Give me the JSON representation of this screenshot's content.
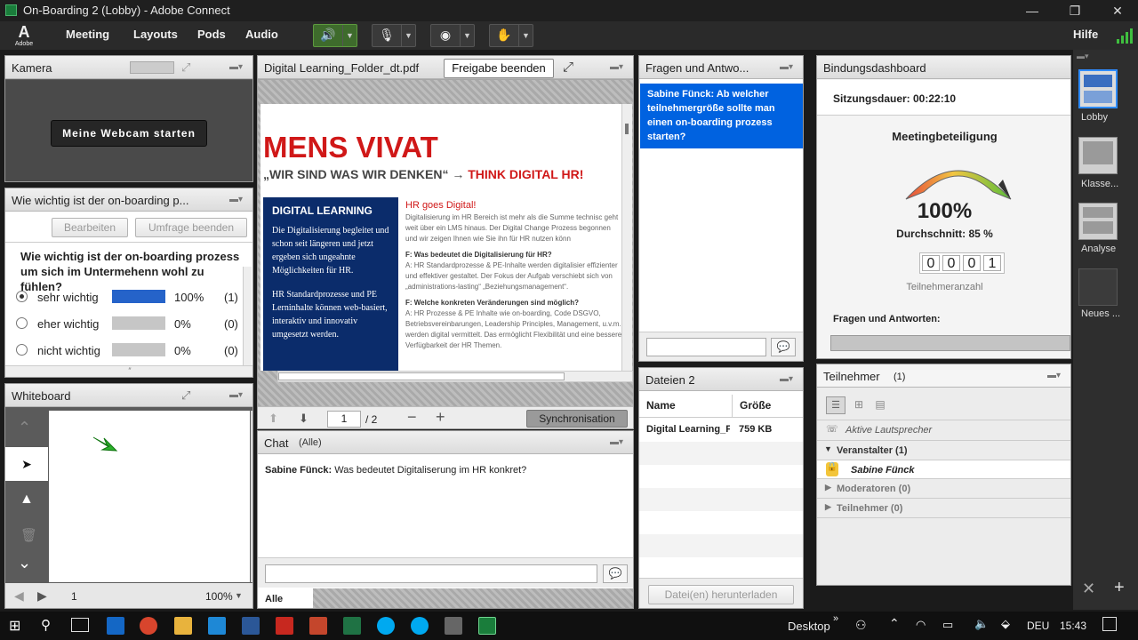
{
  "window": {
    "title": "On-Boarding 2 (Lobby) - Adobe Connect",
    "min": "—",
    "max": "❐",
    "close": "✕"
  },
  "menubar": {
    "logo": "A",
    "logo_text": "Adobe",
    "items": [
      "Meeting",
      "Layouts",
      "Pods",
      "Audio"
    ],
    "help": "Hilfe",
    "speaker_icon": "speaker-icon",
    "mic_icon": "mic-icon",
    "cam_icon": "camera-icon",
    "hand_icon": "raise-hand-icon"
  },
  "camera_pod": {
    "title": "Kamera",
    "start_button": "Meine Webcam starten"
  },
  "poll_pod": {
    "title": "Wie wichtig ist der on-boarding p...",
    "edit_button": "Bearbeiten",
    "end_button": "Umfrage beenden",
    "question": "Wie wichtig ist der on-boarding prozess um sich im Untermehenn wohl zu fühlen?",
    "answers": [
      {
        "label": "sehr wichtig",
        "percent": "100%",
        "count": "(1)",
        "fill": 100,
        "selected": true
      },
      {
        "label": "eher wichtig",
        "percent": "0%",
        "count": "(0)",
        "fill": 0,
        "selected": false
      },
      {
        "label": "nicht wichtig",
        "percent": "0%",
        "count": "(0)",
        "fill": 0,
        "selected": false
      }
    ]
  },
  "whiteboard_pod": {
    "title": "Whiteboard",
    "page": "1",
    "zoom": "100%"
  },
  "share_pod": {
    "filename": "Digital Learning_Folder_dt.pdf",
    "stop_button": "Freigabe beenden",
    "page_current": "1",
    "page_total": "/ 2",
    "sync_button": "Synchronisation",
    "doc": {
      "headline": "MENS VIVAT",
      "subline_a": "„WIR SIND WAS WIR DENKEN“ →",
      "subline_b": "THINK DIGITAL HR!",
      "blue_title": "DIGITAL LEARNING",
      "blue_p1": "Die Digitalisierung begleitet und schon seit längeren und jetzt ergeben sich ungeahnte Möglichkeiten für HR.",
      "blue_p2": "HR Standardprozesse und PE Lerninhalte können web-basiert, interaktiv und innovativ umgesetzt werden.",
      "red_title": "HR goes Digital!",
      "p1": "Digitalisierung im HR Bereich ist mehr als die Summe technisc geht weit über ein LMS hinaus. Der Digital Change Prozess begonnen und wir zeigen Ihnen wie Sie ihn für HR nutzen könn",
      "q1": "F: Was bedeutet die Digitalisierung für HR?",
      "a1": "A: HR Standardprozesse & PE-Inhalte werden digitalisier effizienter und effektiver gestaltet. Der Fokus der Aufgab verschiebt sich von „administrations-lasting“ „Beziehungsmanagement“.",
      "q2": "F: Welche konkreten Veränderungen sind möglich?",
      "a2": "A: HR Prozesse & PE Inhalte wie on-boarding, Code DSGVO, Betriebsvereinbarungen, Leadership Principles, Management, u.v.m. werden digital vermittelt. Das ermöglicht Flexibilität und eine bessere Verfügbarkeit der HR Themen."
    }
  },
  "chat_pod": {
    "title": "Chat",
    "scope": "(Alle)",
    "messages": [
      {
        "author": "Sabine Fünck:",
        "text": "Was bedeutet Digitaliserung im HR konkret?"
      }
    ],
    "tab": "Alle"
  },
  "qa_pod": {
    "title": "Fragen und Antwo...",
    "question": "Sabine Fünck: Ab welcher teilnehmergröße sollte man einen on-boarding prozess starten?"
  },
  "files_pod": {
    "title": "Dateien 2",
    "col_name": "Name",
    "col_size": "Größe",
    "files": [
      {
        "name": "Digital Learning_F",
        "size": "759 KB"
      }
    ],
    "download_button": "Datei(en) herunterladen"
  },
  "dashboard_pod": {
    "title": "Bindungsdashboard",
    "duration_label": "Sitzungsdauer:",
    "duration": "00:22:10",
    "engagement_title": "Meetingbeteiligung",
    "engagement_value": "100%",
    "average": "Durchschnitt: 85 %",
    "digits": [
      "0",
      "0",
      "0",
      "1"
    ],
    "participant_count_label": "Teilnehmeranzahl",
    "qa_label": "Fragen und Antworten:",
    "level": 1.0
  },
  "attendees_pod": {
    "title": "Teilnehmer",
    "count": "(1)",
    "active_speaker": "Aktive Lautsprecher",
    "groups": [
      {
        "label": "Veranstalter (1)",
        "expanded": true
      },
      {
        "label": "Moderatoren (0)",
        "expanded": false
      },
      {
        "label": "Teilnehmer (0)",
        "expanded": false
      }
    ],
    "host_name": "Sabine Fünck"
  },
  "layouts": [
    {
      "label": "Lobby"
    },
    {
      "label": "Klasse..."
    },
    {
      "label": "Analyse"
    },
    {
      "label": "Neues ..."
    }
  ],
  "taskbar": {
    "desktop": "Desktop",
    "lang": "DEU",
    "time": "15:43"
  },
  "colors": {
    "accent_blue": "#0062e0",
    "mic_green": "#2fa52a",
    "brand_red": "#d01818",
    "navy": "#0b2c6b"
  }
}
